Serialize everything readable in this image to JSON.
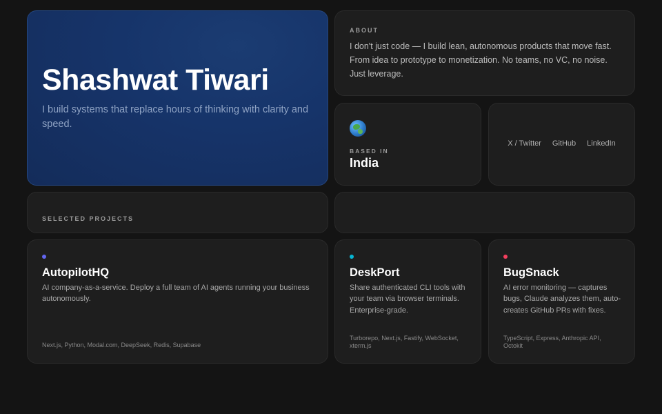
{
  "hero": {
    "name": "Shashwat Tiwari",
    "tagline": "I build systems that replace hours of thinking with clarity and speed."
  },
  "about": {
    "label": "ABOUT",
    "text": "I don't just code — I build lean, autonomous products that move fast. From idea to prototype to monetization. No teams, no VC, no noise. Just leverage."
  },
  "location": {
    "icon": "globe-icon",
    "label": "BASED IN",
    "value": "India"
  },
  "social": {
    "links": [
      "X / Twitter",
      "GitHub",
      "LinkedIn"
    ]
  },
  "projects": {
    "label": "SELECTED PROJECTS",
    "items": [
      {
        "title": "AutopilotHQ",
        "description": "AI company-as-a-service. Deploy a full team of AI agents running your business autonomously.",
        "tech": "Next.js, Python, Modal.com, DeepSeek, Redis, Supabase",
        "accent": "#6366f1"
      },
      {
        "title": "DeskPort",
        "description": "Share authenticated CLI tools with your team via browser terminals. Enterprise-grade.",
        "tech": "Turborepo, Next.js, Fastify, WebSocket, xterm.js",
        "accent": "#06b6d4"
      },
      {
        "title": "BugSnack",
        "description": "AI error monitoring — captures bugs, Claude analyzes them, auto-creates GitHub PRs with fixes.",
        "tech": "TypeScript, Express, Anthropic API, Octokit",
        "accent": "#f43f5e"
      }
    ]
  }
}
